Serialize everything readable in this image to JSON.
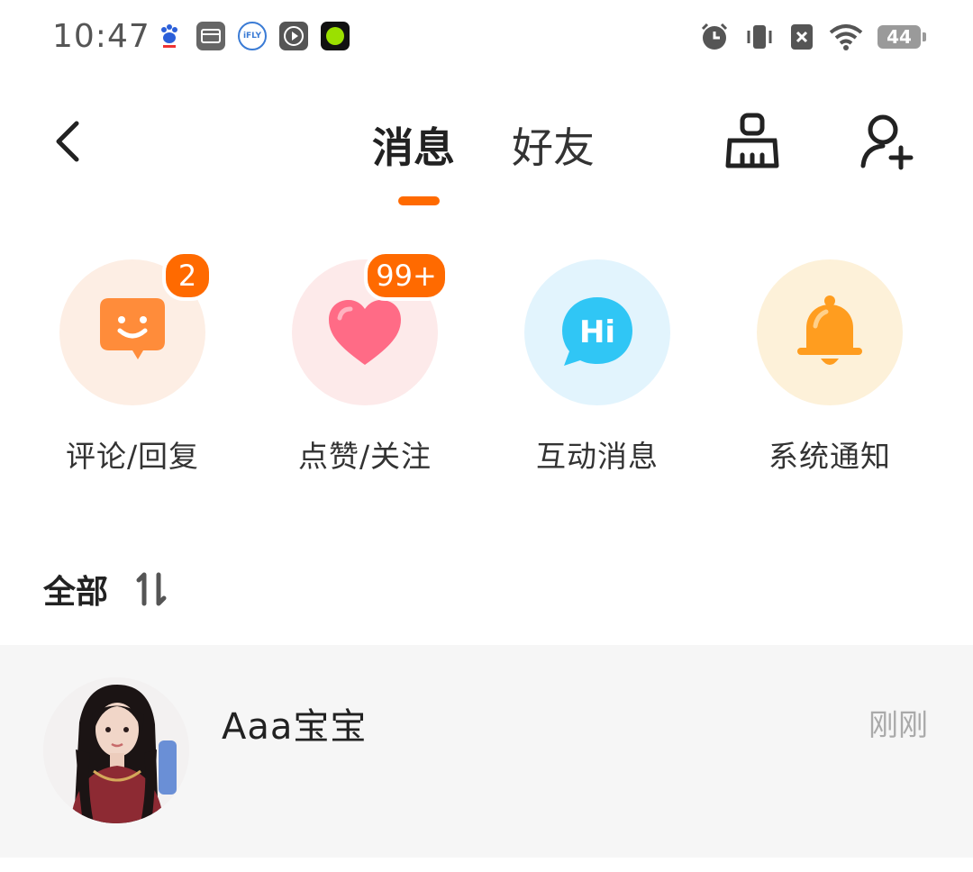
{
  "status_bar": {
    "time": "10:47",
    "battery": "44",
    "left_icons": [
      "baidu-icon",
      "card-icon",
      "ifly-icon",
      "play-icon",
      "green-dot-icon"
    ],
    "right_icons": [
      "alarm-icon",
      "vibrate-icon",
      "no-sim-icon",
      "wifi-icon",
      "battery-icon"
    ]
  },
  "header": {
    "tabs": [
      {
        "label": "消息",
        "active": true
      },
      {
        "label": "好友",
        "active": false
      }
    ],
    "accent_color": "#ff6a00"
  },
  "categories": [
    {
      "label": "评论/回复",
      "badge": "2",
      "icon": "smile-chat-icon",
      "bg": "#fdeee4"
    },
    {
      "label": "点赞/关注",
      "badge": "99+",
      "icon": "heart-icon",
      "bg": "#fdeaea"
    },
    {
      "label": "互动消息",
      "badge": "",
      "icon": "hi-bubble-icon",
      "bg": "#e2f4fd"
    },
    {
      "label": "系统通知",
      "badge": "",
      "icon": "bell-icon",
      "bg": "#fdf1d9"
    }
  ],
  "list": {
    "title": "全部",
    "sort_icon": "sort-icon",
    "conversations": [
      {
        "name": "Aaa宝宝",
        "time": "刚刚"
      }
    ]
  }
}
